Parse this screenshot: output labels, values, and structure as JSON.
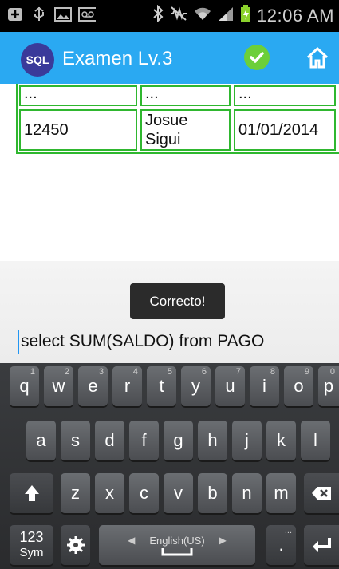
{
  "status_bar": {
    "time": "12:06 AM",
    "left_icons": [
      "add-icon",
      "usb-icon",
      "image-icon",
      "voicemail-icon"
    ],
    "right_icons": [
      "bluetooth-icon",
      "mute-icon",
      "wifi-icon",
      "signal-icon",
      "battery-charging-icon"
    ]
  },
  "action_bar": {
    "logo_text": "SQL",
    "title": "Examen Lv.3",
    "check_icon": "check-circle-icon",
    "home_icon": "home-icon",
    "bg_color": "#2aa9f2"
  },
  "table": {
    "rows": [
      [
        "...",
        "...",
        "..."
      ],
      [
        "12450",
        "Josue Sigui",
        "01/01/2014"
      ]
    ],
    "border_color": "#2fb72f"
  },
  "toast": {
    "text": "Correcto!"
  },
  "query": {
    "value": "select SUM(SALDO) from PAGO"
  },
  "keyboard": {
    "row1": [
      {
        "label": "q",
        "sub": "1"
      },
      {
        "label": "w",
        "sub": "2"
      },
      {
        "label": "e",
        "sub": "3"
      },
      {
        "label": "r",
        "sub": "4"
      },
      {
        "label": "t",
        "sub": "5"
      },
      {
        "label": "y",
        "sub": "6"
      },
      {
        "label": "u",
        "sub": "7"
      },
      {
        "label": "i",
        "sub": "8"
      },
      {
        "label": "o",
        "sub": "9"
      },
      {
        "label": "p",
        "sub": "0"
      }
    ],
    "row2": [
      "a",
      "s",
      "d",
      "f",
      "g",
      "h",
      "j",
      "k",
      "l"
    ],
    "row3": [
      "z",
      "x",
      "c",
      "v",
      "b",
      "n",
      "m"
    ],
    "sym_label": "123",
    "sym_sub": "Sym",
    "space_label": "English(US)",
    "period_label": ".",
    "period_sub": "...",
    "shift_icon": "shift-icon",
    "delete_icon": "backspace-icon",
    "settings_icon": "gear-icon",
    "enter_icon": "enter-icon"
  }
}
